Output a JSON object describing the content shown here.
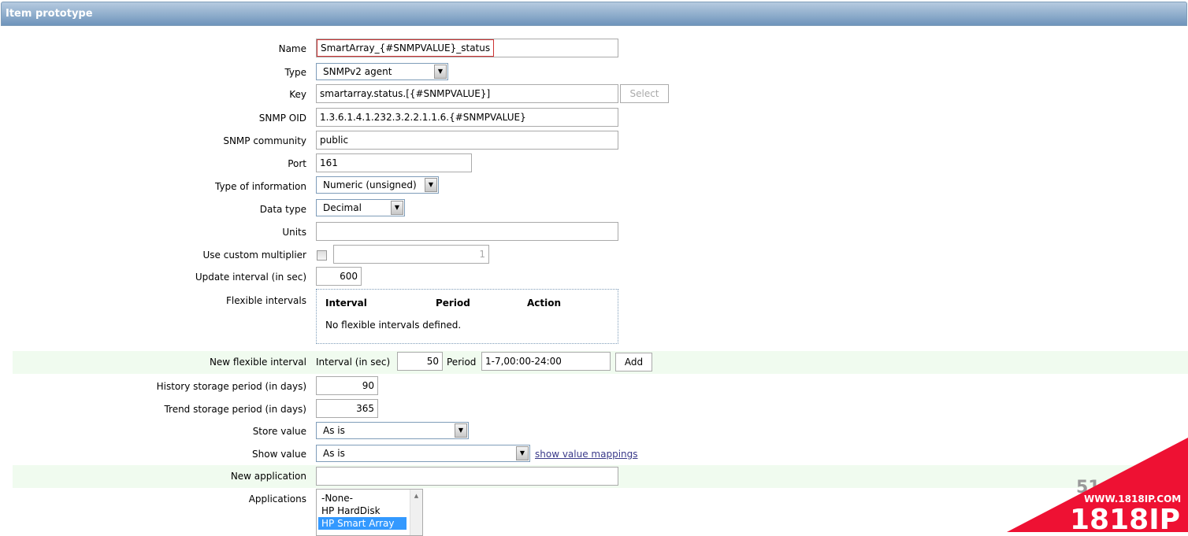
{
  "title": "Item prototype",
  "fields": {
    "name": {
      "label": "Name",
      "value": "SmartArray_{#SNMPVALUE}_status"
    },
    "type": {
      "label": "Type",
      "value": "SNMPv2 agent"
    },
    "key": {
      "label": "Key",
      "value": "smartarray.status.[{#SNMPVALUE}]",
      "select": "Select"
    },
    "oid": {
      "label": "SNMP OID",
      "value": "1.3.6.1.4.1.232.3.2.2.1.1.6.{#SNMPVALUE}"
    },
    "community": {
      "label": "SNMP community",
      "value": "public"
    },
    "port": {
      "label": "Port",
      "value": "161"
    },
    "type_info": {
      "label": "Type of information",
      "value": "Numeric (unsigned)"
    },
    "data_type": {
      "label": "Data type",
      "value": "Decimal"
    },
    "units": {
      "label": "Units",
      "value": ""
    },
    "multiplier": {
      "label": "Use custom multiplier",
      "checked": false,
      "value": "1"
    },
    "update": {
      "label": "Update interval (in sec)",
      "value": "600"
    },
    "flex": {
      "label": "Flexible intervals",
      "headers": [
        "Interval",
        "Period",
        "Action"
      ],
      "empty": "No flexible intervals defined."
    },
    "new_flex": {
      "label": "New flexible interval",
      "interval_label": "Interval (in sec)",
      "interval": "50",
      "period_label": "Period",
      "period": "1-7,00:00-24:00",
      "add": "Add"
    },
    "history": {
      "label": "History storage period (in days)",
      "value": "90"
    },
    "trend": {
      "label": "Trend storage period (in days)",
      "value": "365"
    },
    "store": {
      "label": "Store value",
      "value": "As is"
    },
    "show": {
      "label": "Show value",
      "value": "As is",
      "link": "show value mappings"
    },
    "new_app": {
      "label": "New application",
      "value": ""
    },
    "apps": {
      "label": "Applications",
      "options": [
        "-None-",
        "HP HardDisk",
        "HP Smart Array"
      ],
      "selected": "HP Smart Array"
    }
  },
  "watermark": {
    "url": "WWW.1818IP.COM",
    "brand": "1818IP",
    "partial": "51",
    "color": "#ee1133"
  }
}
